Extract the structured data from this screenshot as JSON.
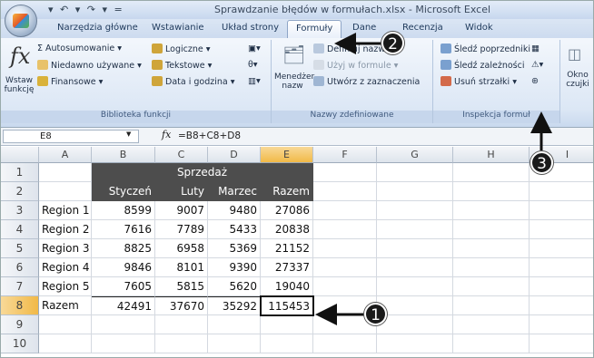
{
  "window": {
    "title": "Sprawdzanie błędów w formułach.xlsx - Microsoft Excel",
    "qat": "▾ ↶ ▾ ↷ ▾ ="
  },
  "tabs": [
    {
      "label": "Narzędzia główne"
    },
    {
      "label": "Wstawianie"
    },
    {
      "label": "Układ strony"
    },
    {
      "label": "Formuły"
    },
    {
      "label": "Dane"
    },
    {
      "label": "Recenzja"
    },
    {
      "label": "Widok"
    }
  ],
  "ribbon": {
    "library": {
      "insert_function": "Wstaw funkcję",
      "autosum": "Σ Autosumowanie ▾",
      "recent": "Niedawno używane ▾",
      "financial": "Finansowe ▾",
      "logical": "Logiczne ▾",
      "text": "Tekstowe ▾",
      "datetime": "Data i godzina ▾",
      "group_label": "Biblioteka funkcji"
    },
    "names": {
      "manager": "Menedżer nazw",
      "define": "Definiuj nazwę ▾",
      "use": "Użyj w formule ▾",
      "create": "Utwórz z zaznaczenia",
      "group_label": "Nazwy zdefiniowane"
    },
    "audit": {
      "trace_precedents": "Śledź poprzedniki",
      "trace_dependents": "Śledź zależności",
      "remove_arrows": "Usuń strzałki ▾",
      "group_label": "Inspekcja formuł",
      "watch": "Okno czujki"
    }
  },
  "formula_bar": {
    "cell_ref": "E8",
    "fx": "fx",
    "formula": "=B8+C8+D8"
  },
  "columns": [
    "A",
    "B",
    "C",
    "D",
    "E",
    "F",
    "G",
    "H",
    "I"
  ],
  "rows": [
    "1",
    "2",
    "3",
    "4",
    "5",
    "6",
    "7",
    "8",
    "9",
    "10"
  ],
  "sheet": {
    "header_title": "Sprzedaż",
    "month_headers": [
      "Styczeń",
      "Luty",
      "Marzec",
      "Razem"
    ],
    "data": [
      {
        "label": "Region 1",
        "values": [
          "8599",
          "9007",
          "9480",
          "27086"
        ]
      },
      {
        "label": "Region 2",
        "values": [
          "7616",
          "7789",
          "5433",
          "20838"
        ]
      },
      {
        "label": "Region 3",
        "values": [
          "8825",
          "6958",
          "5369",
          "21152"
        ]
      },
      {
        "label": "Region 4",
        "values": [
          "9846",
          "8101",
          "9390",
          "27337"
        ]
      },
      {
        "label": "Region 5",
        "values": [
          "7605",
          "5815",
          "5620",
          "19040"
        ]
      },
      {
        "label": "Razem",
        "values": [
          "42491",
          "37670",
          "35292",
          "115453"
        ]
      }
    ]
  },
  "callouts": [
    "1",
    "2",
    "3"
  ]
}
